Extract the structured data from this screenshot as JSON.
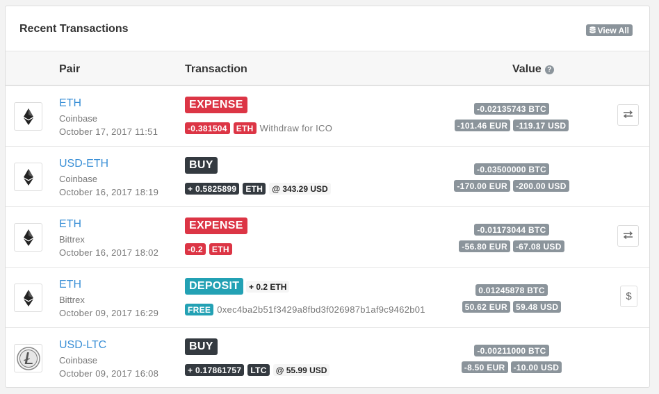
{
  "card": {
    "title": "Recent Transactions",
    "view_all_label": "View All"
  },
  "columns": {
    "pair": "Pair",
    "transaction": "Transaction",
    "value": "Value",
    "value_help": "?"
  },
  "rows": [
    {
      "coin_icon": "ethereum-icon",
      "pair": "ETH",
      "exchange": "Coinbase",
      "date": "October 17, 2017 11:51",
      "type": "EXPENSE",
      "amount": "-0.381504",
      "asset": "ETH",
      "note": "Withdraw for ICO",
      "btc": "-0.02135743 BTC",
      "eur": "-101.46 EUR",
      "usd": "-119.17 USD",
      "action_icon": "transfer-icon"
    },
    {
      "coin_icon": "ethereum-icon",
      "pair": "USD-ETH",
      "exchange": "Coinbase",
      "date": "October 16, 2017 18:19",
      "type": "BUY",
      "amount": "+ 0.5825899",
      "asset": "ETH",
      "price": "@ 343.29 USD",
      "btc": "-0.03500000 BTC",
      "eur": "-170.00 EUR",
      "usd": "-200.00 USD"
    },
    {
      "coin_icon": "ethereum-icon",
      "pair": "ETH",
      "exchange": "Bittrex",
      "date": "October 16, 2017 18:02",
      "type": "EXPENSE",
      "amount": "-0.2",
      "asset": "ETH",
      "btc": "-0.01173044 BTC",
      "eur": "-56.80 EUR",
      "usd": "-67.08 USD",
      "action_icon": "transfer-icon"
    },
    {
      "coin_icon": "ethereum-icon",
      "pair": "ETH",
      "exchange": "Bittrex",
      "date": "October 09, 2017 16:29",
      "type": "DEPOSIT",
      "deposit_amount": "+ 0.2 ETH",
      "fee": "FREE",
      "address": "0xec4ba2b51f3429a8fbd3f026987b1af9c9462b01",
      "btc": "0.01245878 BTC",
      "eur": "50.62 EUR",
      "usd": "59.48 USD",
      "action_icon": "dollar-icon"
    },
    {
      "coin_icon": "litecoin-icon",
      "pair": "USD-LTC",
      "exchange": "Coinbase",
      "date": "October 09, 2017 16:08",
      "type": "BUY",
      "amount": "+ 0.17861757",
      "asset": "LTC",
      "price": "@ 55.99 USD",
      "btc": "-0.00211000 BTC",
      "eur": "-8.50 EUR",
      "usd": "-10.00 USD"
    }
  ],
  "colors": {
    "expense": "#dc3545",
    "buy": "#343a40",
    "deposit": "#23a1b4",
    "value_badge": "#8b949b",
    "link": "#3a8fd6"
  }
}
